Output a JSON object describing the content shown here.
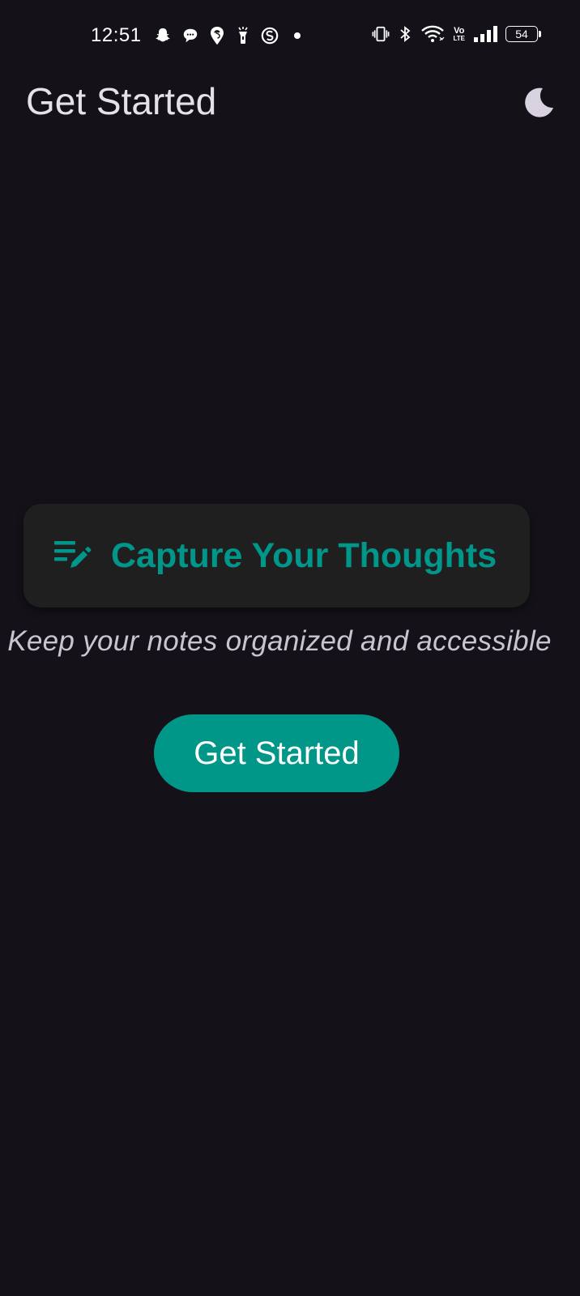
{
  "status_bar": {
    "time": "12:51",
    "notification_icons": [
      "snapchat-icon",
      "chat-bubble-icon",
      "swiggy-icon",
      "torch-app-icon",
      "sync-app-icon",
      "dot-icon"
    ],
    "system_icons": [
      "vibrate-icon",
      "bluetooth-icon",
      "wifi-icon",
      "volte-icon",
      "signal-icon",
      "battery-icon"
    ],
    "volte_label_top": "Vo",
    "volte_label_bottom": "LTE",
    "battery_level": "54"
  },
  "app_bar": {
    "title": "Get Started",
    "theme_toggle_icon": "moon-icon"
  },
  "hero": {
    "icon": "edit-note-icon",
    "headline": "Capture Your Thoughts",
    "subtitle": "Keep your notes organized and accessible"
  },
  "cta": {
    "label": "Get Started"
  },
  "colors": {
    "background": "#141218",
    "card": "#1f1f1f",
    "accent": "#009688",
    "title_text": "#e6e0e9",
    "subtitle_text": "#c9c4cf"
  }
}
